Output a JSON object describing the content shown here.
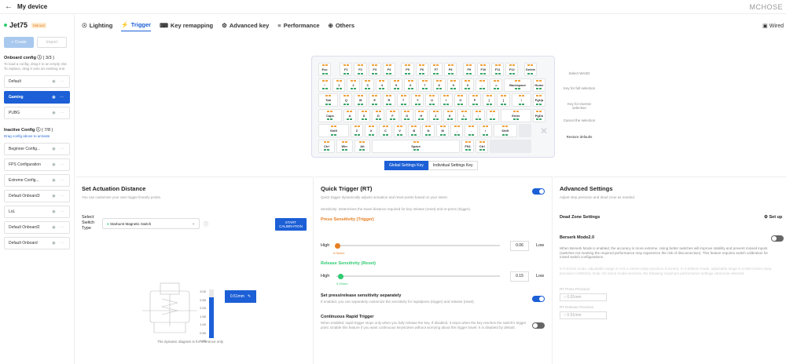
{
  "topbar": {
    "title": "My device",
    "brand": "MCHOSE"
  },
  "sidebar": {
    "device": "Jet75",
    "badge": "Manual",
    "create": "+ Create",
    "import": "Import",
    "onboard_title": "Onboard config",
    "onboard_count": "( 3/3 )",
    "onboard_hint": "To load a config, drag it to an empty slot. To replace, drag it onto an existing one.",
    "onboard": [
      "Default",
      "Gaming",
      "PUBG"
    ],
    "inactive_title": "Inactive Config",
    "inactive_count": "( 7/8 )",
    "inactive_hint": "Drag config above to activate",
    "inactive": [
      "Beginner Config...",
      "FPS Configuration",
      "Extreme Config...",
      "Default Onboard3",
      "LoL",
      "Default Onboard2",
      "Default Onboard"
    ]
  },
  "tabs": [
    "Lighting",
    "Trigger",
    "Key remapping",
    "Advanced key",
    "Performance",
    "Others"
  ],
  "wired": "Wired",
  "keyboard": {
    "rows": [
      [
        [
          "Esc",
          1
        ],
        [
          "",
          0.5,
          "gap"
        ],
        [
          "F1",
          1
        ],
        [
          "F2",
          1
        ],
        [
          "F3",
          1
        ],
        [
          "F4",
          1
        ],
        [
          "",
          0.3,
          "gap"
        ],
        [
          "F5",
          1
        ],
        [
          "F6",
          1
        ],
        [
          "F7",
          1
        ],
        [
          "F8",
          1
        ],
        [
          "",
          0.3,
          "gap"
        ],
        [
          "F9",
          1
        ],
        [
          "F10",
          1
        ],
        [
          "F11",
          1
        ],
        [
          "F12",
          1
        ],
        [
          "",
          0.3,
          "gap"
        ],
        [
          "Delete",
          1
        ]
      ],
      [
        [
          "~",
          1
        ],
        [
          "1",
          1
        ],
        [
          "2",
          1
        ],
        [
          "3",
          1
        ],
        [
          "4",
          1
        ],
        [
          "5",
          1
        ],
        [
          "6",
          1
        ],
        [
          "7",
          1
        ],
        [
          "8",
          1
        ],
        [
          "9",
          1
        ],
        [
          "0",
          1
        ],
        [
          "-",
          1
        ],
        [
          "=",
          1
        ],
        [
          "Backspace",
          2
        ],
        [
          "Home",
          1
        ]
      ],
      [
        [
          "Tab",
          1.5
        ],
        [
          "Q",
          1
        ],
        [
          "W",
          1
        ],
        [
          "E",
          1
        ],
        [
          "R",
          1
        ],
        [
          "T",
          1
        ],
        [
          "Y",
          1
        ],
        [
          "U",
          1
        ],
        [
          "I",
          1
        ],
        [
          "O",
          1
        ],
        [
          "P",
          1
        ],
        [
          "[",
          1
        ],
        [
          "]",
          1
        ],
        [
          "\\",
          1.5
        ],
        [
          "PgUp",
          1
        ]
      ],
      [
        [
          "Caps",
          1.75
        ],
        [
          "A",
          1
        ],
        [
          "S",
          1
        ],
        [
          "D",
          1
        ],
        [
          "F",
          1
        ],
        [
          "G",
          1
        ],
        [
          "H",
          1
        ],
        [
          "J",
          1
        ],
        [
          "K",
          1
        ],
        [
          "L",
          1
        ],
        [
          ";",
          1
        ],
        [
          "'",
          1
        ],
        [
          "Enter",
          2.25
        ],
        [
          "PgDn",
          1
        ]
      ],
      [
        [
          "Shift",
          2.25
        ],
        [
          "Z",
          1
        ],
        [
          "X",
          1
        ],
        [
          "C",
          1
        ],
        [
          "V",
          1
        ],
        [
          "B",
          1
        ],
        [
          "N",
          1
        ],
        [
          "M",
          1
        ],
        [
          ",",
          1
        ],
        [
          ".",
          1
        ],
        [
          "/",
          1
        ],
        [
          "Shift",
          1.75
        ],
        [
          "",
          1,
          "ghost"
        ]
      ],
      [
        [
          "Ctrl",
          1.25
        ],
        [
          "Win",
          1.25
        ],
        [
          "Alt",
          1.25
        ],
        [
          "Space",
          6.25
        ],
        [
          "FN1",
          1
        ],
        [
          "Ctrl",
          1
        ],
        [
          "",
          3,
          "ghost"
        ]
      ]
    ],
    "side": [
      "Select WASD",
      "Key for full selection",
      "Key for inverse selection",
      "Cancel the selection",
      "Restore defaults"
    ],
    "seg": [
      "Global Settings Key",
      "Individual Settings Key"
    ]
  },
  "actuation": {
    "title": "Set Actuation Distance",
    "sub": "You can customize your own trigger linearly points.",
    "switch_label": "Select Switch Type",
    "switch_value": "Starburst Magnetic Switch",
    "start": "START CALIBRATION",
    "reading": "0.51mm",
    "scale": [
      "3.00",
      "2.50",
      "2.00",
      "1.50",
      "1.00",
      "0.50",
      "0.00"
    ],
    "note": "The dynamic diagram is for reference only"
  },
  "rt": {
    "title": "Quick Trigger (RT)",
    "sub": "Quick trigger dynamically adjusts actuation and reset points based on your intent.",
    "sens": "Sensitivity: Determines the travel distance required for key release (reset) and re-press (trigger).",
    "press_title": "Press Sensitivity (Trigger)",
    "press_val": "0.06",
    "press_mm": "0.06mm",
    "release_title": "Release Sensitivity (Reset)",
    "release_val": "0.15",
    "release_mm": "0.15mm",
    "high": "High",
    "low": "Low",
    "sep_title": "Set press/release sensitivity separately",
    "sep_sub": "If enabled, you can separately customize the sensitivity for rapidpress (trigger) and release (reset).",
    "cont_title": "Continuous Rapid Trigger",
    "cont_sub": "When enabled, rapid trigger stops only when you fully release the key. If disabled, it stops when the key reaches the switch's trigger point. Enable this feature if you want continuous keystrokes without worrying about the trigger travel. It is disabled by default."
  },
  "adv": {
    "title": "Advanced Settings",
    "sub": "Adjust step precision and dead zone as needed.",
    "dz": "Dead Zone Settings",
    "setup": "Set up",
    "berserk": "Berserk Mode2.0",
    "berserk_sub": "When Berserk Mode is enabled, the accuracy is more extreme. Using better switches will improve stability and prevent missed inputs (switches not meeting the required performance may experience the risk of disconnection). This feature requires switch calibration for mixed switch configurations.",
    "berserk_gray": "In 0.01mm mode, adjustable range is 0.01-1.04mm (step precision 0.01mm). In 0.005mm mode, adjustable range is 0.005-0.5mm (step precision 0.005mm). Note: On some model versions, the following maximum performance settings cannot be selected.",
    "rt_press": "RT Press Precision",
    "rt_press_val": "0.01mm",
    "rt_release": "RT Release Precision",
    "rt_release_val": "0.01mm"
  }
}
